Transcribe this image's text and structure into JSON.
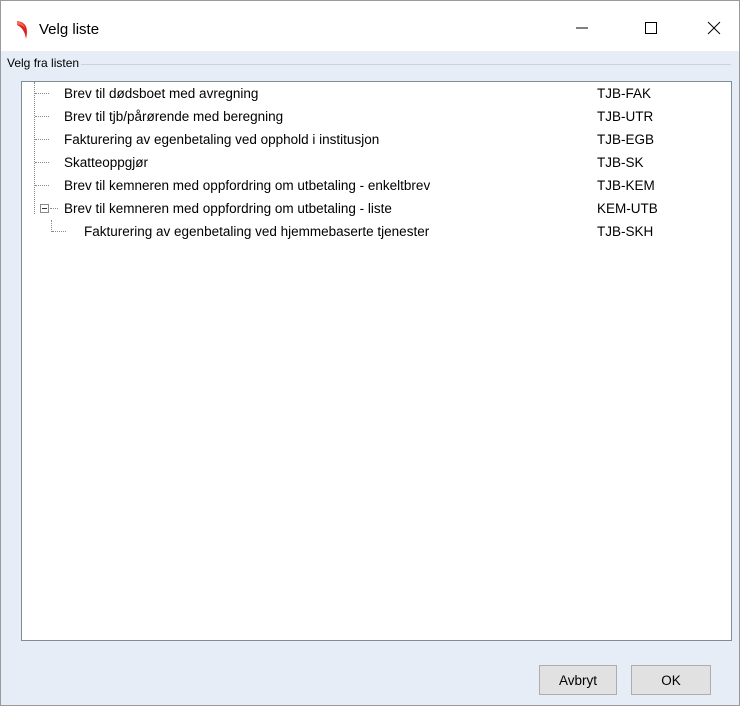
{
  "window": {
    "title": "Velg liste",
    "minimize_glyph": "—",
    "maximize_glyph": "☐",
    "close_glyph": "✕"
  },
  "group": {
    "label": "Velg fra listen"
  },
  "tree": {
    "items": [
      {
        "label": "Brev til dødsboet med avregning",
        "code": "TJB-FAK"
      },
      {
        "label": "Brev til tjb/pårørende med beregning",
        "code": "TJB-UTR"
      },
      {
        "label": "Fakturering av egenbetaling ved opphold i institusjon",
        "code": "TJB-EGB"
      },
      {
        "label": "Skatteoppgjør",
        "code": "TJB-SK"
      },
      {
        "label": "Brev til kemneren med oppfordring om utbetaling - enkeltbrev",
        "code": "TJB-KEM"
      },
      {
        "label": "Brev til kemneren med oppfordring om utbetaling - liste",
        "code": "KEM-UTB",
        "expanded": true
      },
      {
        "label": "Fakturering av egenbetaling ved hjemmebaserte tjenester",
        "code": "TJB-SKH",
        "child": true
      }
    ]
  },
  "buttons": {
    "cancel": "Avbryt",
    "ok": "OK"
  },
  "colors": {
    "accent": "#e2211c",
    "panel": "#e6edf6"
  }
}
